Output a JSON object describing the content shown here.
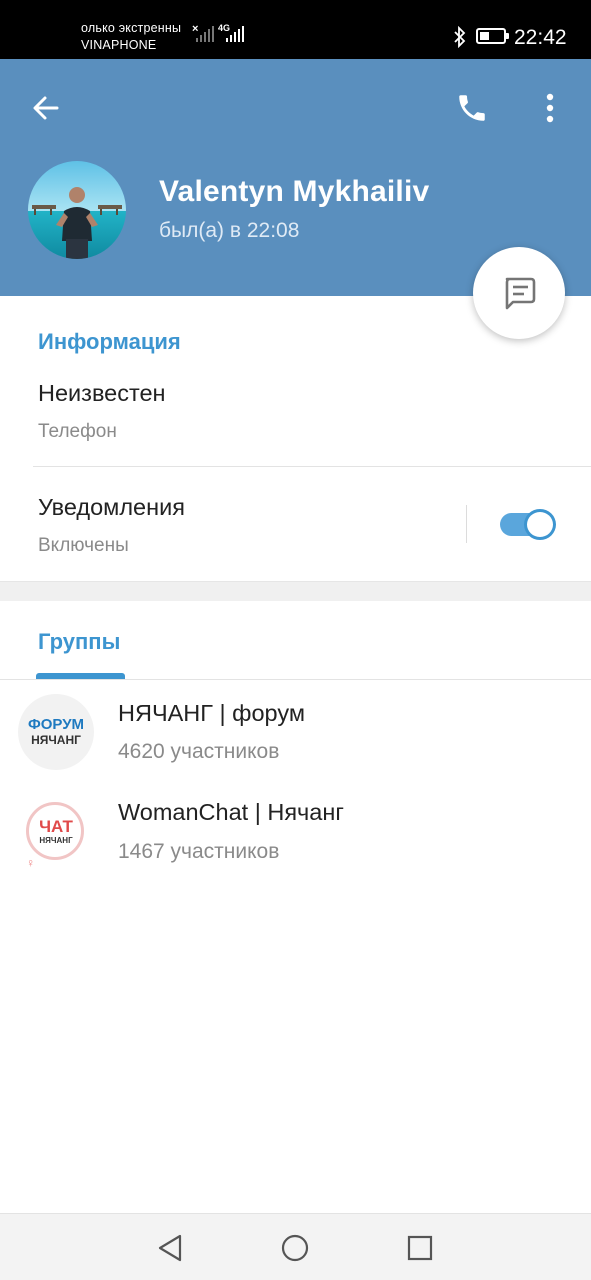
{
  "status_bar": {
    "carrier_line1": "олько экстренны",
    "carrier_line2": "VINAPHONE",
    "network": "4G",
    "time": "22:42",
    "battery_level": 0.4
  },
  "header": {
    "background_color": "#5a8fbe",
    "name": "Valentyn Mykhailiv",
    "last_seen": "был(а) в 22:08"
  },
  "info": {
    "section_title": "Информация",
    "phone_value": "Неизвестен",
    "phone_label": "Телефон",
    "notifications_label": "Уведомления",
    "notifications_value": "Включены",
    "notifications_on": true
  },
  "groups": {
    "tab_label": "Группы",
    "items": [
      {
        "name": "НЯЧАНГ | форум",
        "members": "4620 участников",
        "avatar_top": "ФОРУМ",
        "avatar_bottom": "НЯЧАНГ"
      },
      {
        "name": "WomanChat | Нячанг",
        "members": "1467 участников",
        "avatar_top": "ЧАТ",
        "avatar_bottom": "НЯЧАНГ"
      }
    ]
  },
  "colors": {
    "accent": "#3d95d0",
    "header": "#5a8fbe"
  },
  "icons": {
    "back": "arrow-left-icon",
    "call": "phone-icon",
    "more": "more-vertical-icon",
    "message": "message-icon",
    "nav_back": "triangle-back-icon",
    "nav_home": "circle-home-icon",
    "nav_recent": "square-recent-icon"
  }
}
